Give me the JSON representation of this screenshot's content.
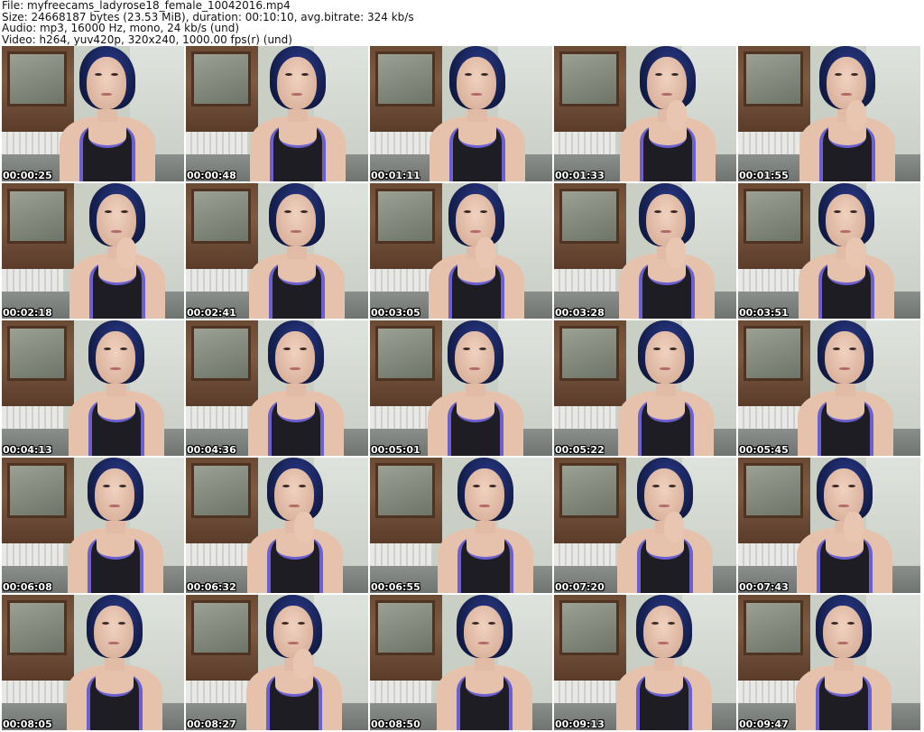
{
  "header": {
    "file_line": "File: myfreecams_ladyrose18_female_10042016.mp4",
    "size_line": "Size: 24668187 bytes (23.53 MiB), duration: 00:10:10, avg.bitrate: 324 kb/s",
    "audio_line": "Audio: mp3, 16000 Hz, mono, 24 kb/s (und)",
    "video_line": "Video: h264, yuv420p, 320x240, 1000.00 fps(r) (und)"
  },
  "colors": {
    "background": "#ffffff",
    "header_text": "#111111",
    "timestamp_text": "#ffffff",
    "tank_top": "#1e1d24",
    "tank_trim": "#6c5fcf",
    "hair": "#152050"
  },
  "thumbnails": [
    {
      "timestamp": "00:00:25",
      "pose": "neutral"
    },
    {
      "timestamp": "00:00:48",
      "pose": "neutral"
    },
    {
      "timestamp": "00:01:11",
      "pose": "neutral"
    },
    {
      "timestamp": "00:01:33",
      "pose": "hand-chin"
    },
    {
      "timestamp": "00:01:55",
      "pose": "hand-chin"
    },
    {
      "timestamp": "00:02:18",
      "pose": "hand-chin"
    },
    {
      "timestamp": "00:02:41",
      "pose": "neutral"
    },
    {
      "timestamp": "00:03:05",
      "pose": "hand-chin"
    },
    {
      "timestamp": "00:03:28",
      "pose": "hand-chin"
    },
    {
      "timestamp": "00:03:51",
      "pose": "hand-chin"
    },
    {
      "timestamp": "00:04:13",
      "pose": "neutral"
    },
    {
      "timestamp": "00:04:36",
      "pose": "neutral"
    },
    {
      "timestamp": "00:05:01",
      "pose": "neutral"
    },
    {
      "timestamp": "00:05:22",
      "pose": "neutral"
    },
    {
      "timestamp": "00:05:45",
      "pose": "neutral"
    },
    {
      "timestamp": "00:06:08",
      "pose": "neutral"
    },
    {
      "timestamp": "00:06:32",
      "pose": "hand-chin"
    },
    {
      "timestamp": "00:06:55",
      "pose": "neutral"
    },
    {
      "timestamp": "00:07:20",
      "pose": "hand-chin"
    },
    {
      "timestamp": "00:07:43",
      "pose": "hand-chin"
    },
    {
      "timestamp": "00:08:05",
      "pose": "neutral"
    },
    {
      "timestamp": "00:08:27",
      "pose": "hand-chin"
    },
    {
      "timestamp": "00:08:50",
      "pose": "neutral"
    },
    {
      "timestamp": "00:09:13",
      "pose": "neutral"
    },
    {
      "timestamp": "00:09:47",
      "pose": "neutral"
    }
  ]
}
